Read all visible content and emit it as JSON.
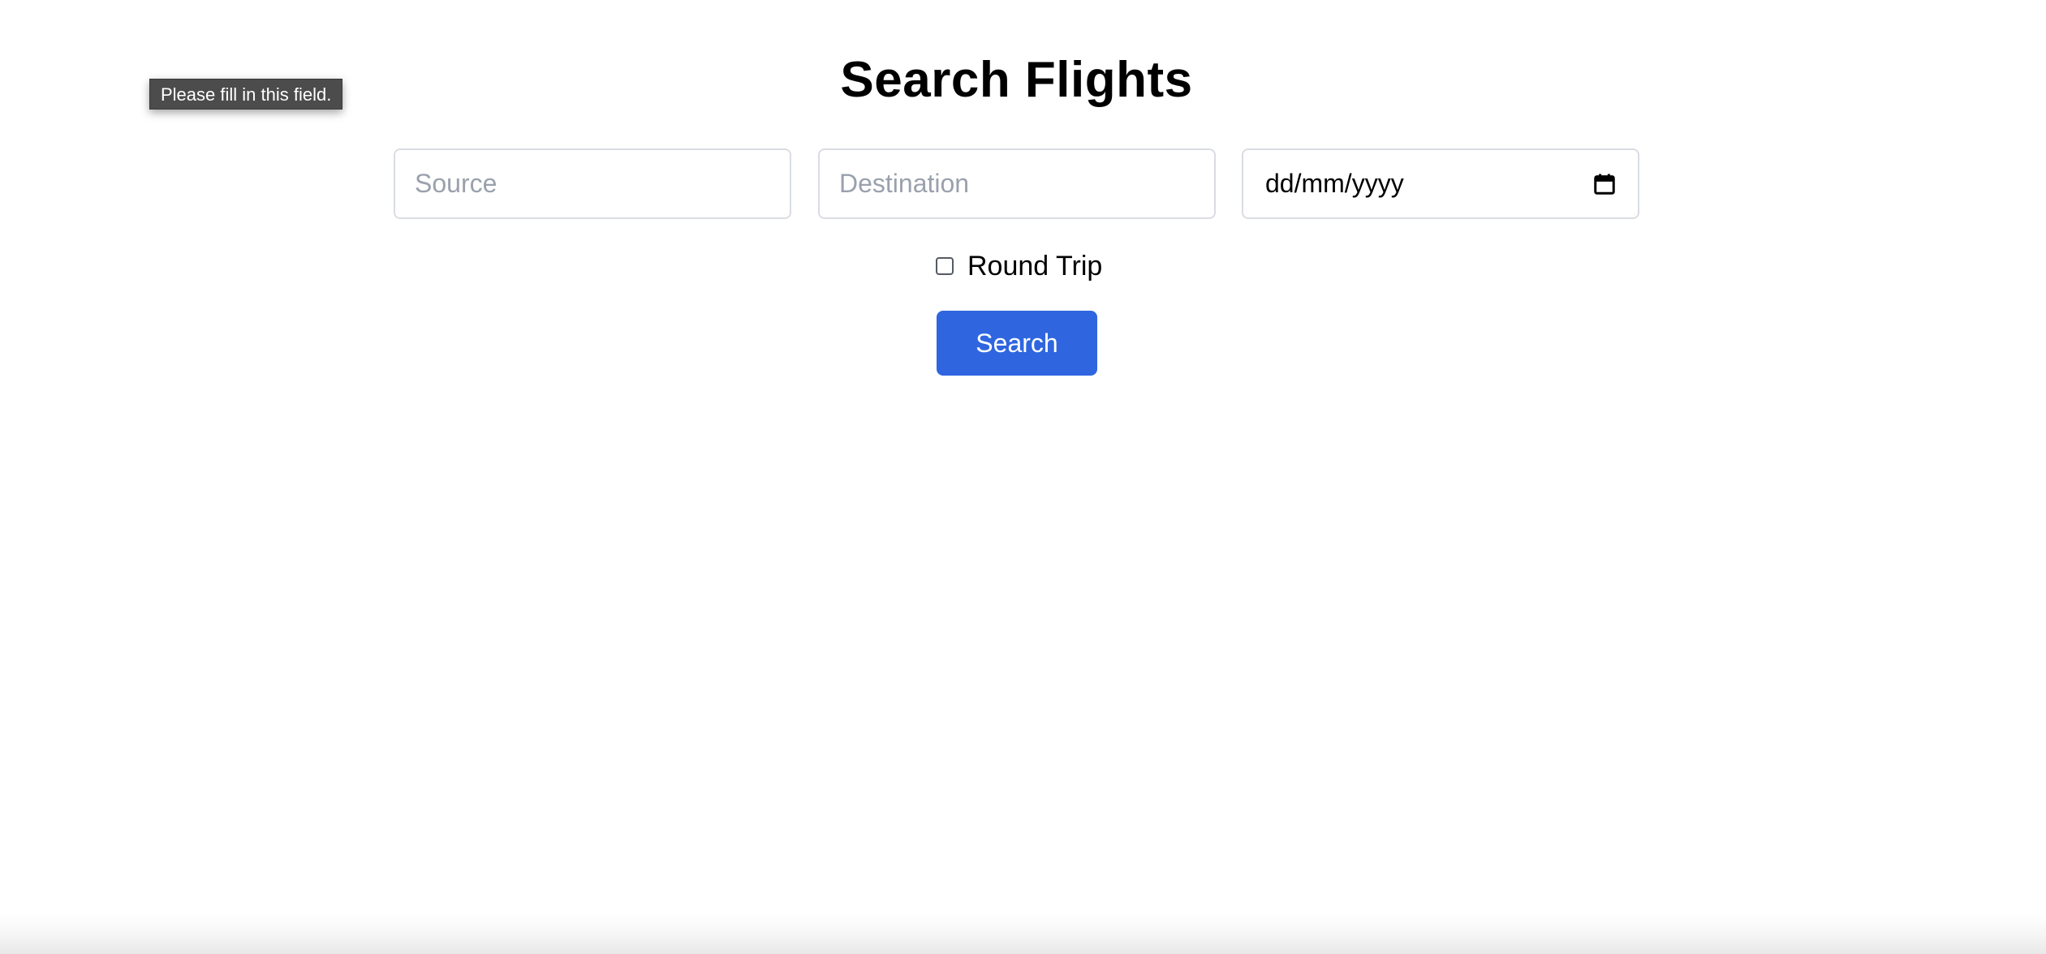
{
  "page": {
    "title": "Search Flights"
  },
  "form": {
    "source": {
      "placeholder": "Source",
      "value": ""
    },
    "destination": {
      "placeholder": "Destination",
      "value": ""
    },
    "date": {
      "display": "dd/mm/yyyy",
      "icon": "calendar-icon"
    },
    "round_trip": {
      "label": "Round Trip",
      "checked": false
    },
    "search_label": "Search"
  },
  "validation_tooltip": {
    "text": "Please fill in this field."
  },
  "colors": {
    "accent": "#2f66e0",
    "input_border": "#d9dde3",
    "placeholder": "#9aa1ad",
    "tooltip_background": "#4c4c4c"
  }
}
